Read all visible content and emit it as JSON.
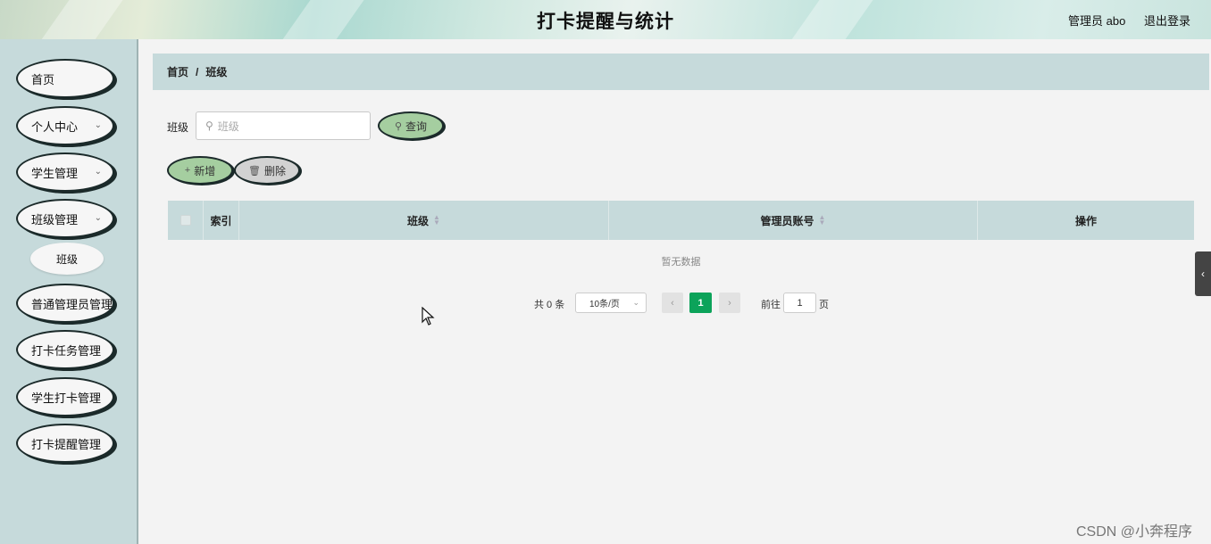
{
  "header": {
    "title": "打卡提醒与统计",
    "user_label": "管理员 abo",
    "logout_label": "退出登录"
  },
  "sidebar": {
    "items": [
      {
        "label": "首页"
      },
      {
        "label": "个人中心"
      },
      {
        "label": "学生管理"
      },
      {
        "label": "班级管理"
      },
      {
        "label": "普通管理员管理"
      },
      {
        "label": "打卡任务管理"
      },
      {
        "label": "学生打卡管理"
      },
      {
        "label": "打卡提醒管理"
      }
    ],
    "subitem": {
      "label": "班级"
    }
  },
  "breadcrumb": {
    "home": "首页",
    "separator": "/",
    "current": "班级"
  },
  "search": {
    "label": "班级",
    "placeholder": "班级",
    "query_label": "查询"
  },
  "actions": {
    "add_label": "新增",
    "delete_label": "删除"
  },
  "table": {
    "columns": [
      "索引",
      "班级",
      "管理员账号",
      "操作"
    ],
    "empty_text": "暂无数据"
  },
  "pagination": {
    "total": "共 0 条",
    "page_size": "10条/页",
    "current_page": "1",
    "goto_label": "前往",
    "goto_value": "1",
    "page_suffix": "页"
  },
  "watermark": "CSDN @小奔程序",
  "colors": {
    "accent_green": "#0ca35a",
    "pill_green": "#a5cea0",
    "sidebar_bg": "#c6dadb"
  }
}
